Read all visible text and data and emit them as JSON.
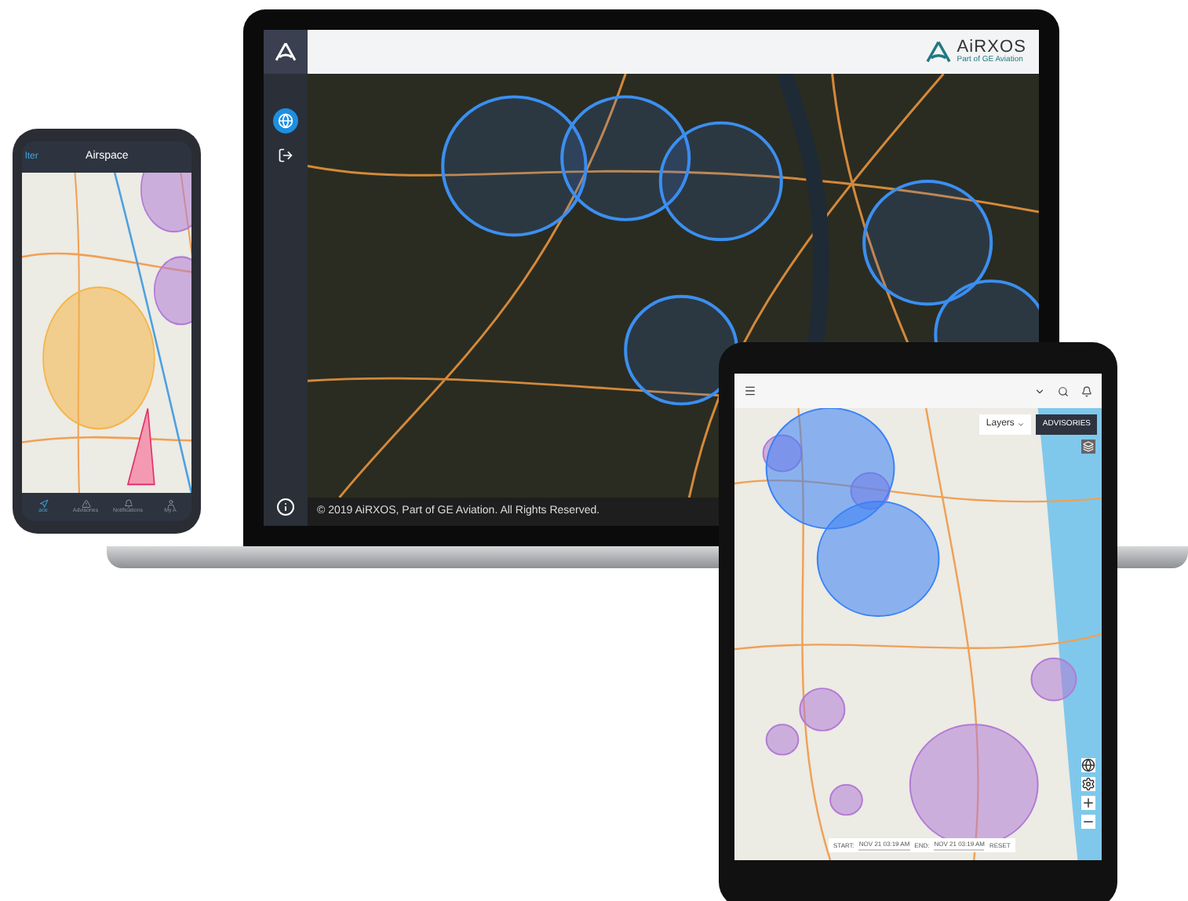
{
  "laptop": {
    "brand": "AiRXOS",
    "tagline": "Part of GE Aviation",
    "sidebar": [
      {
        "kind": "globe",
        "selected": true
      },
      {
        "kind": "exit",
        "selected": false
      }
    ],
    "footer": "© 2019 AiRXOS, Part of GE Aviation. All Rights Reserved."
  },
  "phone": {
    "back": "lter",
    "title": "Airspace",
    "tabs": [
      {
        "label": "ace",
        "selected": true
      },
      {
        "label": "Advisories",
        "selected": false
      },
      {
        "label": "Notifications",
        "selected": false
      },
      {
        "label": "My A",
        "selected": false
      }
    ]
  },
  "tablet": {
    "layers": "Layers",
    "advisories": "ADVISORIES",
    "timebar": {
      "start_label": "START:",
      "start": "NOV 21 03:19 AM",
      "end_label": "END:",
      "end": "NOV 21 03:19 AM",
      "reset": "RESET"
    }
  }
}
